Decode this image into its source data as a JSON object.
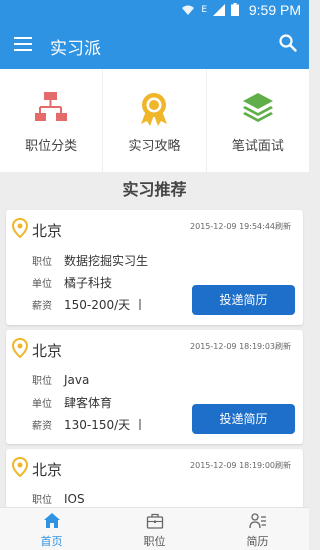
{
  "status": {
    "time": "9:59 PM",
    "network": "E"
  },
  "appbar": {
    "title": "实习派"
  },
  "quick": [
    {
      "label": "职位分类",
      "icon": "org-chart-icon"
    },
    {
      "label": "实习攻略",
      "icon": "award-ribbon-icon"
    },
    {
      "label": "笔试面试",
      "icon": "layers-icon"
    }
  ],
  "section": {
    "title": "实习推荐"
  },
  "cards": [
    {
      "city": "北京",
      "date": "2015-12-09 19:54:44刷新",
      "rows": [
        {
          "k": "职位",
          "v": "数据挖掘实习生"
        },
        {
          "k": "单位",
          "v": "橘子科技"
        },
        {
          "k": "薪资",
          "v": "150-200/天 丨"
        }
      ],
      "button": "投递简历"
    },
    {
      "city": "北京",
      "date": "2015-12-09 18:19:03刷新",
      "rows": [
        {
          "k": "职位",
          "v": "Java"
        },
        {
          "k": "单位",
          "v": "肆客体育"
        },
        {
          "k": "薪资",
          "v": "130-150/天 丨"
        }
      ],
      "button": "投递简历"
    },
    {
      "city": "北京",
      "date": "2015-12-09 18:19:00刷新",
      "rows": [
        {
          "k": "职位",
          "v": "IOS"
        }
      ],
      "button": ""
    }
  ],
  "tabs": [
    {
      "label": "首页",
      "icon": "home-icon",
      "active": true
    },
    {
      "label": "职位",
      "icon": "briefcase-icon",
      "active": false
    },
    {
      "label": "简历",
      "icon": "resume-icon",
      "active": false
    }
  ],
  "colors": {
    "primary": "#2f93e3",
    "button": "#1e6fc9",
    "pin": "#f0b62a",
    "org": "#e56b6b",
    "layers": "#5fae4a"
  }
}
